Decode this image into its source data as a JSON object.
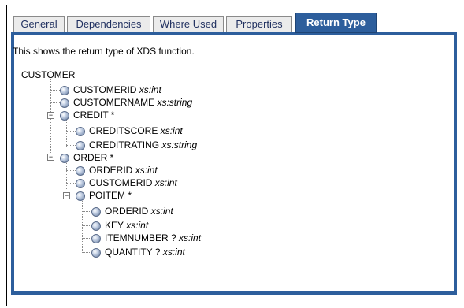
{
  "tabs": [
    {
      "label": "General",
      "active": false
    },
    {
      "label": "Dependencies",
      "active": false
    },
    {
      "label": "Where Used",
      "active": false
    },
    {
      "label": "Properties",
      "active": false
    },
    {
      "label": "Return Type",
      "active": true
    }
  ],
  "description": "This shows the return type of XDS function.",
  "tree": {
    "root": "CUSTOMER",
    "items": [
      {
        "name": "CUSTOMERID",
        "type": "xs:int"
      },
      {
        "name": "CUSTOMERNAME",
        "type": "xs:string"
      },
      {
        "name": "CREDIT *",
        "type": ""
      },
      {
        "name": "CREDITSCORE",
        "type": "xs:int"
      },
      {
        "name": "CREDITRATING",
        "type": "xs:string"
      },
      {
        "name": "ORDER *",
        "type": ""
      },
      {
        "name": "ORDERID",
        "type": "xs:int"
      },
      {
        "name": "CUSTOMERID",
        "type": "xs:int"
      },
      {
        "name": "POITEM *",
        "type": ""
      },
      {
        "name": "ORDERID",
        "type": "xs:int"
      },
      {
        "name": "KEY",
        "type": "xs:int"
      },
      {
        "name": "ITEMNUMBER ?",
        "type": "xs:int"
      },
      {
        "name": "QUANTITY ?",
        "type": "xs:int"
      }
    ]
  },
  "colors": {
    "accent": "#2d5e9c",
    "tab_bg": "#ebebeb"
  }
}
